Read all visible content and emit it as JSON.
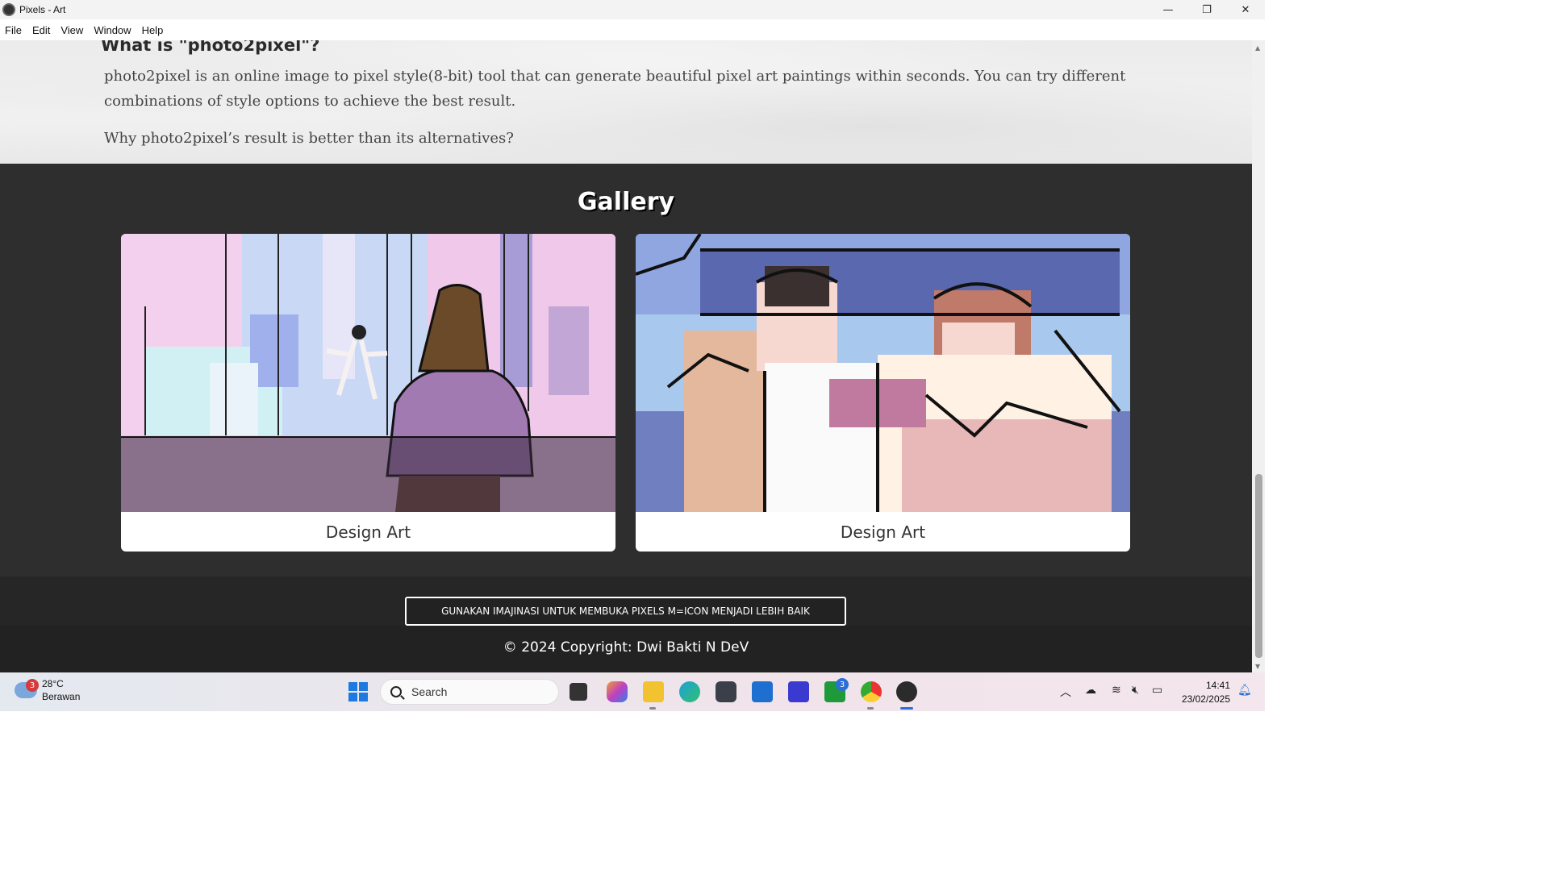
{
  "window": {
    "title": "Pixels - Art",
    "minimize": "—",
    "maximize": "❐",
    "close": "✕"
  },
  "menu": [
    "File",
    "Edit",
    "View",
    "Window",
    "Help"
  ],
  "hero": {
    "heading": "What is \"photo2pixel\"?",
    "paragraph1": "photo2pixel is an online image to pixel style(8-bit) tool that can generate beautiful pixel art paintings within seconds. You can try different combinations of style options to achieve the best result.",
    "paragraph2": "Why photo2pixel’s result is better than its alternatives?"
  },
  "gallery": {
    "title": "Gallery",
    "cards": [
      {
        "caption": "Design Art"
      },
      {
        "caption": "Design Art"
      }
    ]
  },
  "footer": {
    "cta": "GUNAKAN IMAJINASI UNTUK MEMBUKA PIXELS M=ICON MENJADI LEBIH BAIK",
    "copyright": "© 2024 Copyright: Dwi Bakti N DeV"
  },
  "taskbar": {
    "weather_badge": "3",
    "temperature": "28°C",
    "condition": "Berawan",
    "search_label": "Search",
    "xbox_badge": "3",
    "time": "14:41",
    "date": "23/02/2025"
  },
  "colors": {
    "gallery_bg": "#2e2e2e",
    "footer_bg": "#222222",
    "accent": "#2a6fd6"
  }
}
